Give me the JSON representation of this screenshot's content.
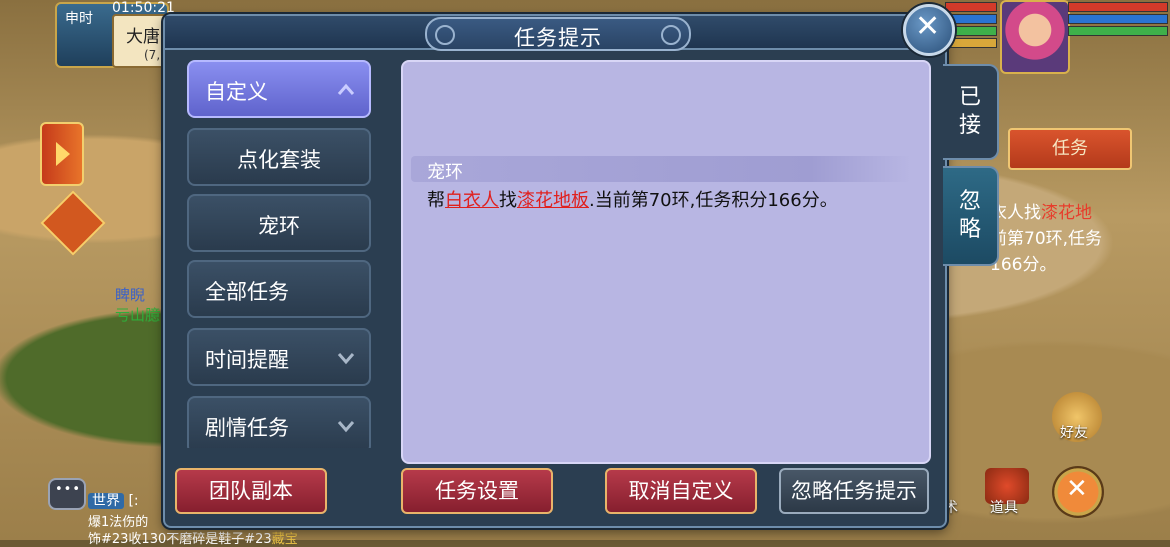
{
  "hud": {
    "time_label": "申时",
    "clock": "01:50:21",
    "city_name": "大唐",
    "city_coords": "(7,",
    "npc_left_line1": "睥睨",
    "npc_left_line2": "亏山臆",
    "friend_label": "好友",
    "item_label": "道具",
    "skill_label": "术",
    "side_task_button": "任务",
    "side_task_text_1": "衣人找",
    "side_task_text_1_red": "漆花地",
    "side_task_text_2": "前第70环,任务",
    "side_task_text_3": "166分。"
  },
  "chat": {
    "channel": "世界",
    "line1": "[:",
    "line2": "爆1法伤的",
    "line3_prefix": "饰#23收130不磨碎是鞋子#23",
    "line3_highlight": "藏宝"
  },
  "dialog": {
    "title": "任务提示",
    "categories": [
      {
        "label": "自定义",
        "state": "expanded"
      },
      {
        "label": "点化套装",
        "state": "sub"
      },
      {
        "label": "宠环",
        "state": "sub"
      },
      {
        "label": "全部任务",
        "state": "none"
      },
      {
        "label": "时间提醒",
        "state": "collapsed"
      },
      {
        "label": "剧情任务",
        "state": "collapsed"
      }
    ],
    "task": {
      "title": "宠环",
      "desc_prefix": "帮",
      "npc": "白衣人",
      "desc_mid": "找",
      "item": "漆花地板",
      "desc_suffix": ".当前第70环,任务积分166分。"
    },
    "tabs": {
      "accepted": "已\n接",
      "ignored": "忽\n略"
    },
    "buttons": {
      "team_dungeon": "团队副本",
      "task_settings": "任务设置",
      "cancel_custom": "取消自定义",
      "ignore_prompt": "忽略任务提示"
    }
  },
  "colors": {
    "active_category": "#6f74dd",
    "panel": "#b8b6e3",
    "red_button": "#a0303d",
    "link_red": "#e0201e"
  }
}
